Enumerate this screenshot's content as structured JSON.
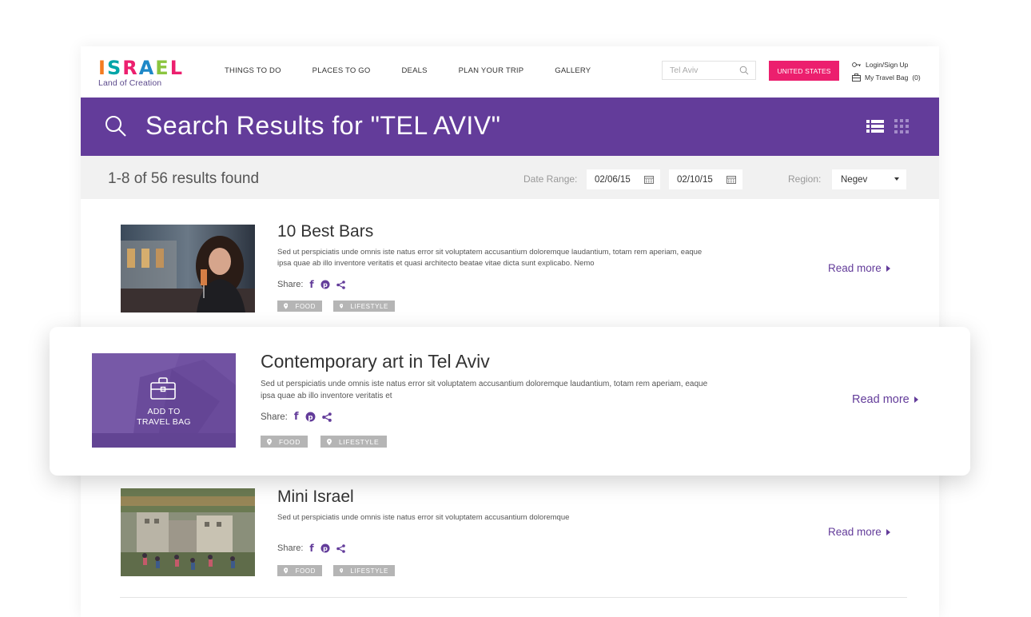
{
  "header": {
    "logo_text": "ISRAEL",
    "logo_colors": [
      "#f47b20",
      "#00a5a8",
      "#ec1f6e",
      "#1e88c7",
      "#8bc53f",
      "#ec1f6e"
    ],
    "logo_tagline": "Land of Creation",
    "nav": [
      "THINGS TO DO",
      "PLACES TO GO",
      "DEALS",
      "PLAN YOUR TRIP",
      "GALLERY"
    ],
    "search_value": "Tel Aviv",
    "country_button": "UNITED STATES",
    "login_label": "Login/Sign Up",
    "travel_bag_label": "My Travel Bag",
    "travel_bag_count": "(0)"
  },
  "banner": {
    "title": "Search Results for \"TEL AVIV\"",
    "color": "#633c9a"
  },
  "filter": {
    "results_count": "1-8 of 56 results found",
    "date_range_label": "Date Range:",
    "date_from": "02/06/15",
    "date_to": "02/10/15",
    "region_label": "Region:",
    "region_value": "Negev"
  },
  "results": [
    {
      "title": "10 Best Bars",
      "description": "Sed ut perspiciatis unde omnis iste natus error sit voluptatem accusantium doloremque laudantium, totam rem aperiam, eaque ipsa quae ab illo inventore veritatis et quasi architecto beatae vitae dicta sunt explicabo. Nemo",
      "share_label": "Share:",
      "tags": [
        "FOOD",
        "LIFESTYLE"
      ],
      "read_more": "Read more"
    },
    {
      "title": "Contemporary art in Tel Aviv",
      "description": "Sed ut perspiciatis unde omnis iste natus error sit voluptatem accusantium doloremque laudantium, totam rem aperiam, eaque ipsa quae ab illo inventore veritatis et",
      "share_label": "Share:",
      "tags": [
        "FOOD",
        "LIFESTYLE"
      ],
      "read_more": "Read more",
      "add_to_bag_line1": "ADD TO",
      "add_to_bag_line2": "TRAVEL BAG"
    },
    {
      "title": "Mini Israel",
      "description": "Sed ut perspiciatis unde omnis iste natus error sit voluptatem accusantium doloremque",
      "share_label": "Share:",
      "tags": [
        "FOOD",
        "LIFESTYLE"
      ],
      "read_more": "Read more"
    }
  ],
  "colors": {
    "accent_purple": "#633c9a",
    "accent_pink": "#ec1f6e",
    "tag_gray": "#b5b5b5"
  }
}
